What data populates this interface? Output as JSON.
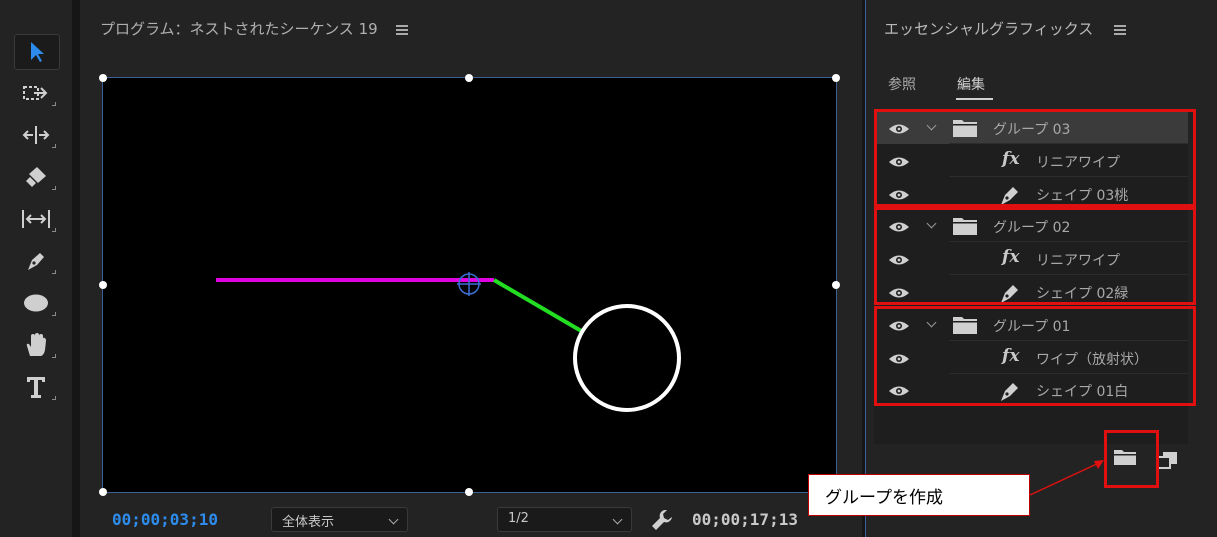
{
  "program": {
    "title": "プログラム：ネストされたシーケンス 19",
    "timecode_current": "00;00;03;10",
    "zoom": "全体表示",
    "resolution": "1/2",
    "timecode_duration": "00;00;17;13"
  },
  "tools": [
    "selection-tool",
    "track-select-tool",
    "ripple-edit-tool",
    "razor-tool",
    "slip-tool",
    "pen-tool",
    "ellipse-tool",
    "hand-tool",
    "type-tool"
  ],
  "essential_graphics": {
    "title": "エッセンシャルグラフィックス",
    "tabs": {
      "browse": "参照",
      "edit": "編集"
    },
    "layers": [
      {
        "type": "group",
        "label": "グループ 03",
        "selected": true
      },
      {
        "type": "effect",
        "label": "リニアワイプ"
      },
      {
        "type": "shape",
        "label": "シェイプ 03桃"
      },
      {
        "type": "group",
        "label": "グループ 02"
      },
      {
        "type": "effect",
        "label": "リニアワイプ"
      },
      {
        "type": "shape",
        "label": "シェイプ 02緑"
      },
      {
        "type": "group",
        "label": "グループ 01"
      },
      {
        "type": "effect",
        "label": "ワイプ（放射状）"
      },
      {
        "type": "shape",
        "label": "シェイプ 01白"
      }
    ]
  },
  "callout": {
    "text": "グループを作成"
  },
  "colors": {
    "accent": "#2d8ceb",
    "highlight_red": "#e01010",
    "line_magenta": "#e000e0",
    "line_green": "#22dd22",
    "circle_white": "#ffffff"
  }
}
